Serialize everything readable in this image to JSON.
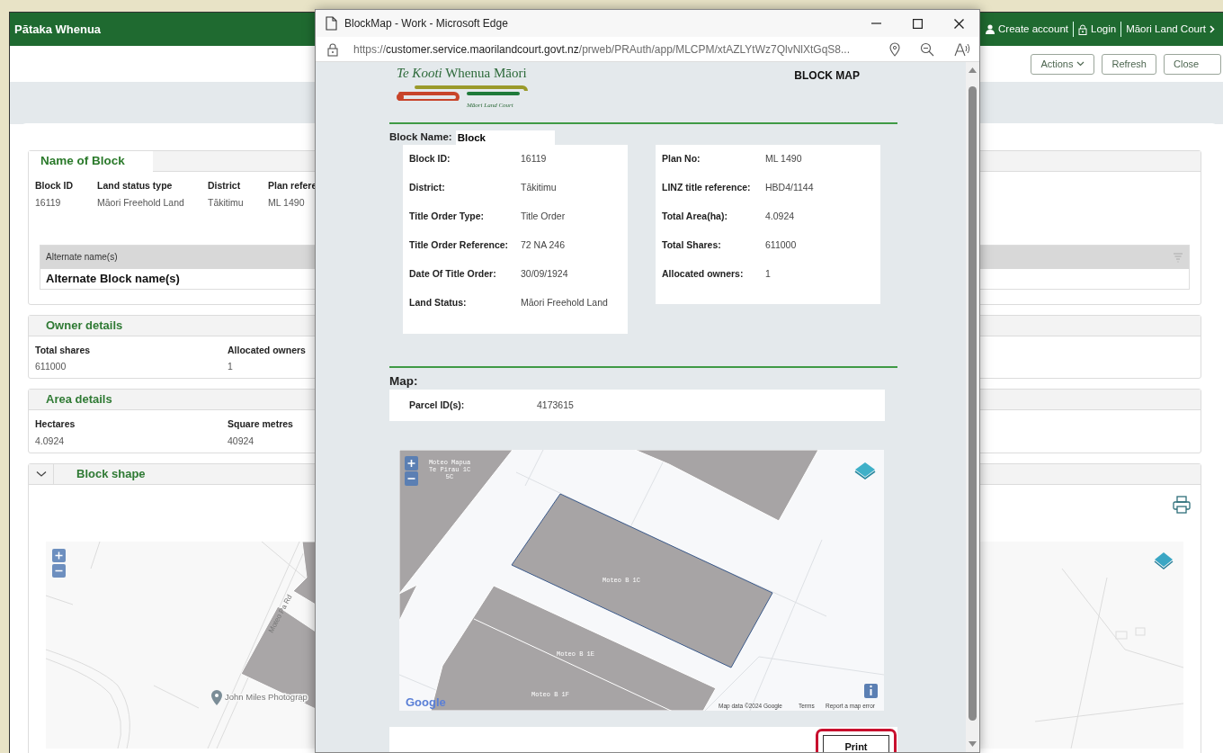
{
  "app": {
    "title": "Pātaka Whenua",
    "header_links": [
      {
        "label": "Create account"
      },
      {
        "label": "Login"
      },
      {
        "label": "Māori Land Court"
      }
    ],
    "toolbar": [
      {
        "label": "Actions",
        "kind": "dropdown"
      },
      {
        "label": "Refresh",
        "kind": "button"
      },
      {
        "label": "Close",
        "kind": "button"
      }
    ],
    "sections": [
      {
        "kind": "tabbed_fields",
        "title": "Name of Block",
        "fields": [
          {
            "label": "Block ID",
            "value": "16119"
          },
          {
            "label": "Land status type",
            "value": "Māori Freehold Land"
          },
          {
            "label": "District",
            "value": "Tākitimu"
          },
          {
            "label": "Plan refere",
            "value": "ML 1490"
          }
        ],
        "grid": {
          "column": "Alternate name(s)",
          "rows": [
            "Alternate Block name(s)"
          ]
        }
      },
      {
        "kind": "fields",
        "title": "Owner details",
        "fields": [
          {
            "label": "Total shares",
            "value": "611000"
          },
          {
            "label": "Allocated owners",
            "value": "1"
          }
        ]
      },
      {
        "kind": "fields",
        "title": "Area details",
        "fields": [
          {
            "label": "Hectares",
            "value": "4.0924"
          },
          {
            "label": "Square metres",
            "value": "40924"
          }
        ]
      },
      {
        "kind": "map",
        "title": "Block shape",
        "expanded": true,
        "map": {
          "road_label": "Moteo Pa Rd",
          "place_label": "John Miles Photograp"
        }
      }
    ]
  },
  "popup": {
    "title": "BlockMap - Work - Microsoft Edge",
    "url": {
      "scheme": "https://",
      "host": "customer.service.maorilandcourt.govt.nz",
      "path": "/prweb/PRAuth/app/MLCPM/xtAZLYtWz7QlvNlXtGqS8..."
    },
    "logo": {
      "name": "*Te Kooti* Whenua Māori",
      "subtitle": "Māori Land Court"
    },
    "heading": "BLOCK MAP",
    "block_name": {
      "label": "Block Name:",
      "value": "Block"
    },
    "details_left": [
      {
        "label": "Block ID:",
        "value": "16119"
      },
      {
        "label": "District:",
        "value": "Tākitimu"
      },
      {
        "label": "Title Order Type:",
        "value": "Title Order"
      },
      {
        "label": "Title Order Reference:",
        "value": "72 NA 246"
      },
      {
        "label": "Date Of Title Order:",
        "value": "30/09/1924"
      },
      {
        "label": "Land Status:",
        "value": "Māori Freehold Land"
      }
    ],
    "details_right": [
      {
        "label": "Plan No:",
        "value": "ML 1490"
      },
      {
        "label": "LINZ title reference:",
        "value": "HBD4/1144"
      },
      {
        "label": "Total Area(ha):",
        "value": "4.0924"
      },
      {
        "label": "Total Shares:",
        "value": "611000"
      },
      {
        "label": "Allocated owners:",
        "value": "1"
      }
    ],
    "map_heading": "Map:",
    "parcel": {
      "label": "Parcel ID(s):",
      "value": "4173615"
    },
    "map": {
      "labels": [
        {
          "lines": [
            "Moteo Mapua",
            "Te Pirau 1C",
            "5C"
          ]
        },
        {
          "lines": [
            "Moteo B 1C"
          ]
        },
        {
          "lines": [
            "Moteo B 1E"
          ]
        },
        {
          "lines": [
            "Moteo B 1F"
          ]
        }
      ],
      "logo": "Google",
      "attribution": [
        "Map data ©2024 Google",
        "Terms",
        "Report a map error"
      ]
    },
    "print_button": {
      "label": "Print",
      "highlighted": true
    }
  }
}
